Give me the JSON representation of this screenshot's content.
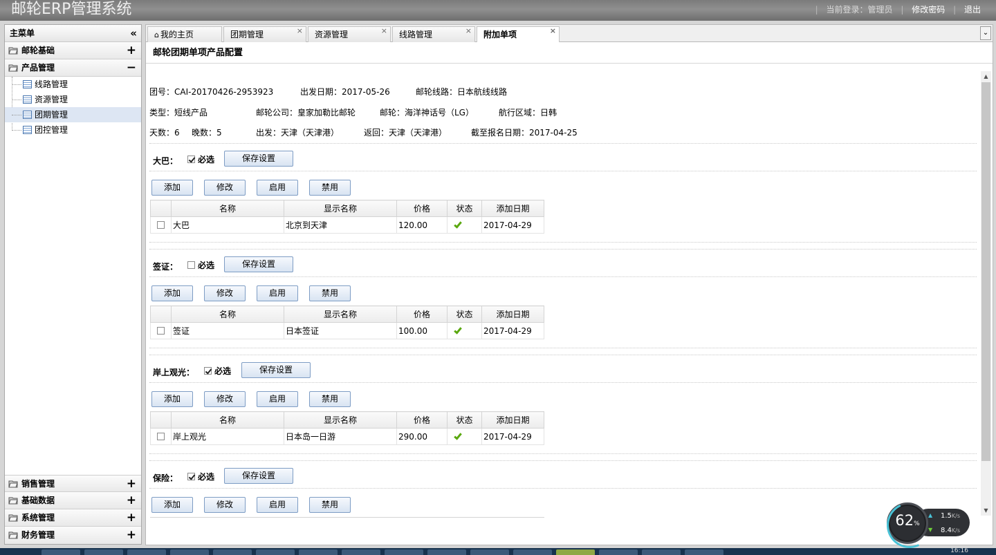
{
  "header": {
    "app_title": "邮轮ERP管理系统",
    "current_user": "当前登录：管理员",
    "change_password": "修改密码",
    "logout": "退出"
  },
  "menu": {
    "title": "主菜单",
    "collapse_icon": "«",
    "groups_top": [
      {
        "label": "邮轮基础",
        "toggle": "+"
      },
      {
        "label": "产品管理",
        "toggle": "−"
      }
    ],
    "tree_items": [
      "线路管理",
      "资源管理",
      "团期管理",
      "团控管理"
    ],
    "selected_item": "团期管理",
    "groups_bottom": [
      {
        "label": "销售管理",
        "toggle": "+"
      },
      {
        "label": "基础数据",
        "toggle": "+"
      },
      {
        "label": "系统管理",
        "toggle": "+"
      },
      {
        "label": "财务管理",
        "toggle": "+"
      }
    ]
  },
  "tabs": [
    {
      "label": "我的主页",
      "closable": false
    },
    {
      "label": "团期管理",
      "closable": true
    },
    {
      "label": "资源管理",
      "closable": true
    },
    {
      "label": "线路管理",
      "closable": true
    },
    {
      "label": "附加单项",
      "closable": true,
      "active": true
    }
  ],
  "tab_close_glyph": "×",
  "tab_menu_glyph": "⌄",
  "page_title": "邮轮团期单项产品配置",
  "info": {
    "row1": [
      "团号：CAI-20170426-2953923",
      "出发日期：2017-05-26",
      "邮轮线路：日本航线线路"
    ],
    "row2": [
      "类型：短线产品",
      "邮轮公司：皇家加勒比邮轮",
      "邮轮：海洋神话号（LG）",
      "航行区域：日韩"
    ],
    "row3": [
      "天数：6",
      "晚数：5",
      "出发：天津（天津港）",
      "返回：天津（天津港）",
      "截至报名日期：2017-04-25"
    ]
  },
  "labels": {
    "required": "必选",
    "save_settings": "保存设置",
    "add": "添加",
    "edit": "修改",
    "enable": "启用",
    "disable": "禁用"
  },
  "table_headers": [
    "名称",
    "显示名称",
    "价格",
    "状态",
    "添加日期"
  ],
  "sections": [
    {
      "label": "大巴：",
      "required": true,
      "row": {
        "name": "大巴",
        "display": "北京到天津",
        "price": "120.00",
        "status": "enabled",
        "date": "2017-04-29"
      }
    },
    {
      "label": "签证：",
      "required": false,
      "row": {
        "name": "签证",
        "display": "日本签证",
        "price": "100.00",
        "status": "enabled",
        "date": "2017-04-29"
      }
    },
    {
      "label": "岸上观光：",
      "required": true,
      "row": {
        "name": "岸上观光",
        "display": "日本岛一日游",
        "price": "290.00",
        "status": "enabled",
        "date": "2017-04-29"
      }
    },
    {
      "label": "保险：",
      "required": true,
      "row": null
    }
  ],
  "net_widget": {
    "percent": "62",
    "percent_unit": "%",
    "up": "1.5",
    "down": "8.4",
    "unit": "K/s"
  },
  "clock": "16:16"
}
